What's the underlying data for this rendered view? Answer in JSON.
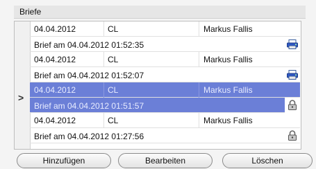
{
  "panel": {
    "title": "Briefe"
  },
  "rows": [
    {
      "date": "04.04.2012",
      "code": "CL",
      "name": "Markus Fallis",
      "desc": "Brief am 04.04.2012 01:52:35",
      "icon": "printer-icon"
    },
    {
      "date": "04.04.2012",
      "code": "CL",
      "name": "Markus Fallis",
      "desc": "Brief am 04.04.2012 01:52:07",
      "icon": "printer-icon"
    },
    {
      "date": "04.04.2012",
      "code": "CL",
      "name": "Markus Fallis",
      "desc": "Brief am 04.04.2012 01:51:57",
      "icon": "lock-icon",
      "selected": true
    },
    {
      "date": "04.04.2012",
      "code": "CL",
      "name": "Markus Fallis",
      "desc": "Brief am 04.04.2012 01:27:56",
      "icon": "lock-icon"
    }
  ],
  "current_row_marker": ">",
  "buttons": {
    "add": "Hinzufügen",
    "edit": "Bearbeiten",
    "delete": "Löschen"
  },
  "colors": {
    "selection": "#6b7fd7"
  }
}
